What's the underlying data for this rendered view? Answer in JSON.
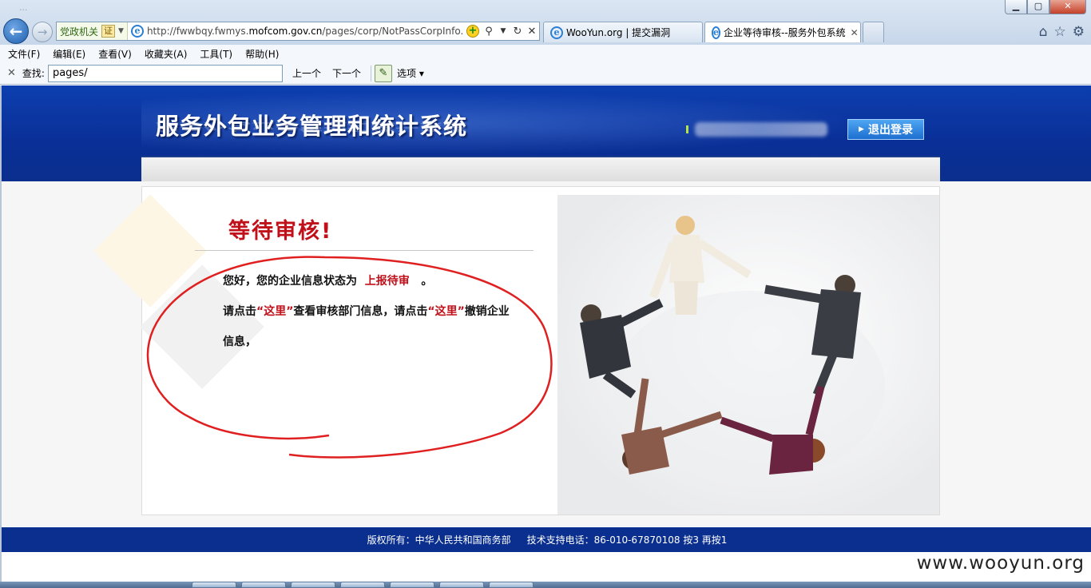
{
  "window": {
    "ghost_title": "...",
    "buttons": {
      "minimize": "▁",
      "maximize": "▢",
      "close": "✕"
    }
  },
  "nav": {
    "back_icon": "back-arrow-icon",
    "forward_icon": "forward-arrow-icon"
  },
  "address_bar": {
    "zone_label": "党政机关",
    "cert_label": "证",
    "url_prefix": "http://fwwbqy.fwmys.",
    "url_domain": "mofcom.gov.cn",
    "url_suffix": "/pages/corp/NotPassCorpInfo.l"
  },
  "tabs": [
    {
      "title": "WooYun.org | 提交漏洞",
      "active": false
    },
    {
      "title": "企业等待审核--服务外包系统",
      "active": true
    }
  ],
  "menu": [
    "文件(F)",
    "编辑(E)",
    "查看(V)",
    "收藏夹(A)",
    "工具(T)",
    "帮助(H)"
  ],
  "find_bar": {
    "label": "查找:",
    "value": "pages/",
    "prev": "上一个",
    "next": "下一个",
    "options": "选项"
  },
  "page": {
    "system_title": "服务外包业务管理和统计系统",
    "logout_label": "退出登录",
    "wait_title": "等待审核!",
    "msg_line1_pre": "您好，您的企业信息状态为",
    "msg_status": "上报待审",
    "msg_line1_post": "。",
    "msg_line2_a": "请点击",
    "msg_link1": "“这里”",
    "msg_line2_b": "查看审核部门信息，请点击",
    "msg_link2": "“这里”",
    "msg_line2_c": "撤销企业",
    "msg_line3": "信息，"
  },
  "footer": {
    "copyright": "版权所有：中华人民共和国商务部",
    "support": "技术支持电话：86-010-67870108 按3 再按1"
  },
  "watermark": "www.wooyun.org",
  "colors": {
    "header_blue": "#0a2f96",
    "accent_red": "#c0101a",
    "annotation_red": "#e02020"
  }
}
